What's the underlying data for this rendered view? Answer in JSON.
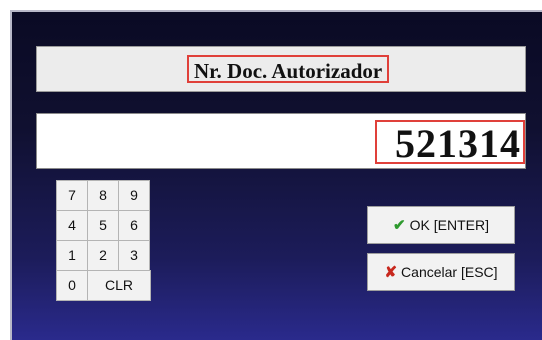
{
  "dialog": {
    "title": "Nr. Doc. Autorizador",
    "value": "521314"
  },
  "keypad": {
    "keys": [
      "7",
      "8",
      "9",
      "4",
      "5",
      "6",
      "1",
      "2",
      "3",
      "0",
      "CLR"
    ]
  },
  "buttons": {
    "ok_label": "OK [ENTER]",
    "ok_icon": "check-icon",
    "ok_icon_glyph": "✔",
    "ok_icon_color": "#2e9a2e",
    "cancel_label": "Cancelar [ESC]",
    "cancel_icon": "x-icon",
    "cancel_icon_glyph": "✘",
    "cancel_icon_color": "#c8281e"
  },
  "colors": {
    "highlight_border": "#e0403a",
    "background_top": "#0a0a24",
    "background_bottom": "#2a2a8c"
  }
}
